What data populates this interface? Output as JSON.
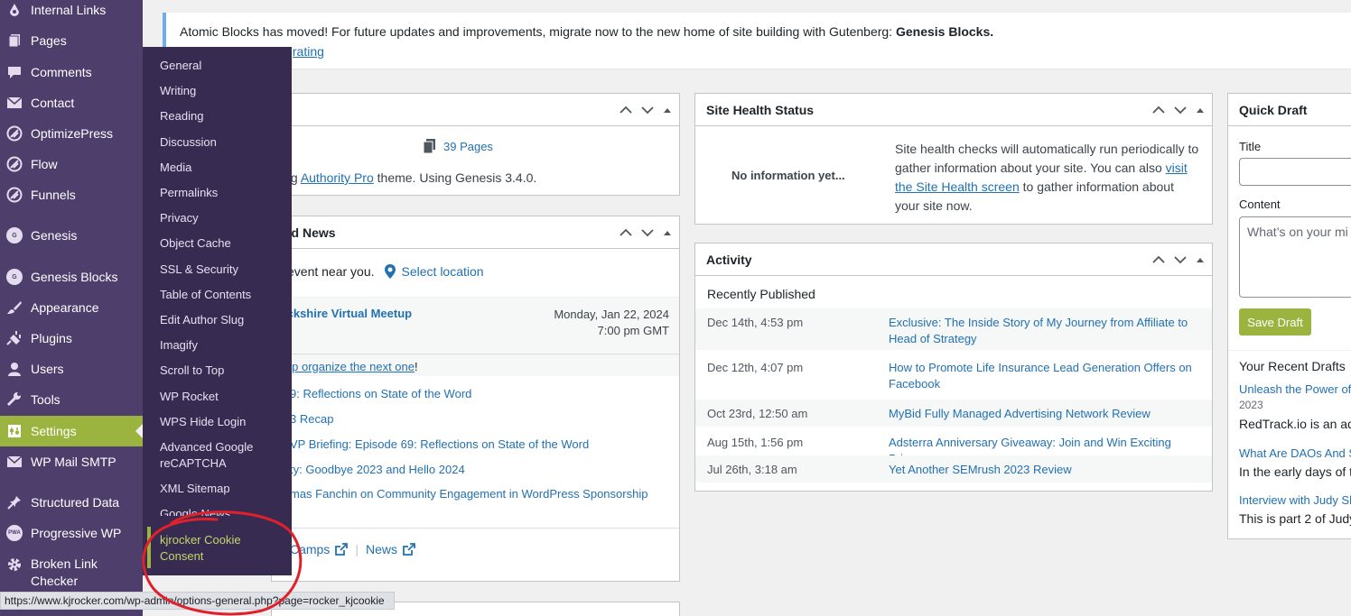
{
  "sidebar": {
    "items": [
      {
        "label": "Internal Links",
        "icon": "link-icon"
      },
      {
        "label": "Pages",
        "icon": "pages-icon"
      },
      {
        "label": "Comments",
        "icon": "comment-icon"
      },
      {
        "label": "Contact",
        "icon": "mail-icon"
      },
      {
        "label": "OptimizePress",
        "icon": "optimizepress-icon"
      },
      {
        "label": "Flow",
        "icon": "flow-icon"
      },
      {
        "label": "Funnels",
        "icon": "funnels-icon"
      },
      {
        "label": "Genesis",
        "icon": "genesis-icon"
      },
      {
        "label": "Genesis Blocks",
        "icon": "genesis-blocks-icon"
      },
      {
        "label": "Appearance",
        "icon": "brush-icon"
      },
      {
        "label": "Plugins",
        "icon": "plugin-icon"
      },
      {
        "label": "Users",
        "icon": "user-icon"
      },
      {
        "label": "Tools",
        "icon": "wrench-icon"
      },
      {
        "label": "Settings",
        "icon": "settings-icon"
      },
      {
        "label": "WP Mail SMTP",
        "icon": "mail-icon"
      },
      {
        "label": "Structured Data",
        "icon": "pin-icon"
      },
      {
        "label": "Progressive WP",
        "icon": "pwa-icon"
      },
      {
        "label": "Broken Link",
        "label2": "Checker",
        "icon": "gear-icon"
      }
    ],
    "genesis_badge": "G",
    "pwa_badge": "PWA"
  },
  "settings_submenu": [
    "General",
    "Writing",
    "Reading",
    "Discussion",
    "Media",
    "Permalinks",
    "Privacy",
    "Object Cache",
    "SSL & Security",
    "Table of Contents",
    "Edit Author Slug",
    "Imagify",
    "Scroll to Top",
    "WP Rocket",
    "WPS Hide Login",
    "Advanced Google",
    "reCAPTCHA",
    "XML Sitemap",
    "Google News",
    "kjrocker Cookie",
    "Consent"
  ],
  "notice": {
    "text": "Atomic Blocks has moved! For future updates and improvements, migrate now to the new home of site building with Gutenberg:",
    "bold": "Genesis Blocks.",
    "link_partial": "igrating"
  },
  "at_a_glance": {
    "pages": "39 Pages",
    "theme_prefix": "ing",
    "theme_link": "Authority Pro",
    "theme_suffix": "theme. Using Genesis 3.4.0."
  },
  "events": {
    "title_partial": "nd News",
    "near_text": "event near you.",
    "select_location": "Select location",
    "meetup_title": "ickshire Virtual Meetup",
    "meetup_date": "Monday, Jan 22, 2024",
    "meetup_time": "7:00 pm GMT",
    "organize_link": "elp organize the next one",
    "organize_suffix": "!",
    "news": [
      "9: Reflections on State of the Word",
      "3 Recap",
      "VP Briefing: Episode 69: Reflections on State of the Word",
      "ty: Goodbye 2023 and Hello 2024",
      "mas Fanchin on Community Engagement in WordPress Sponsorship"
    ],
    "footer_camps": "Camps",
    "footer_news": "News"
  },
  "site_health": {
    "title": "Site Health Status",
    "no_info": "No information yet...",
    "desc_1": "Site health checks will automatically run periodically to",
    "desc_2a": "gather information about your site. You can also",
    "desc_link_1": "visit",
    "desc_link_2": "the Site Health screen",
    "desc_3": "to gather information about",
    "desc_4": "your site now."
  },
  "activity": {
    "title": "Activity",
    "recently_published": "Recently Published",
    "rows": [
      {
        "date": "Dec 14th, 4:53 pm",
        "title_1": "Exclusive: The Inside Story of My Journey from Affiliate to",
        "title_2": "Head of Strategy"
      },
      {
        "date": "Dec 12th, 4:07 pm",
        "title_1": "How to Promote Life Insurance Lead Generation Offers on",
        "title_2": "Facebook"
      },
      {
        "date": "Oct 23rd, 12:50 am",
        "title_1": "MyBid Fully Managed Advertising Network Review",
        "title_2": ""
      },
      {
        "date": "Aug 15th, 1:56 pm",
        "title_1": "Adsterra Anniversary Giveaway: Join and Win Exciting Prizes",
        "title_2": ""
      },
      {
        "date": "Jul 26th, 3:18 am",
        "title_1": "Yet Another SEMrush 2023 Review",
        "title_2": ""
      }
    ]
  },
  "quick_draft": {
    "title": "Quick Draft",
    "title_label": "Title",
    "content_label": "Content",
    "content_placeholder": "What’s on your mi",
    "save_label": "Save Draft",
    "recent_drafts": "Your Recent Drafts",
    "drafts": [
      {
        "link": "Unleash the Power of",
        "meta": "2023",
        "excerpt": "RedTrack.io is an adv"
      },
      {
        "link": "What Are DAOs And S",
        "meta": "",
        "excerpt": "In the early days of t"
      },
      {
        "link": "Interview with Judy Sh",
        "meta": "",
        "excerpt": "This is part 2 of Judy"
      }
    ]
  },
  "statusbar": {
    "url": "https://www.kjrocker.com/wp-admin/options-general.php?page=rocker_kjcookie"
  },
  "colors": {
    "sidebar": "#4d3e6b",
    "flyout": "#382b51",
    "accent": "#9bb43f",
    "link": "#2271b1",
    "annotation": "#e0202a"
  }
}
